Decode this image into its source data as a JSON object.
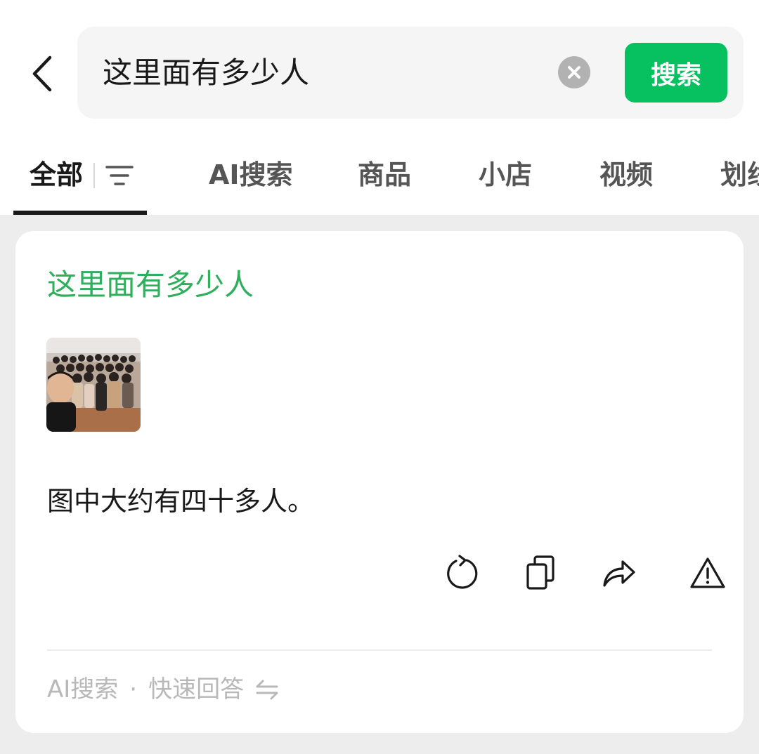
{
  "search": {
    "query": "这里面有多少人",
    "button_label": "搜索"
  },
  "tabs": [
    {
      "label": "全部",
      "active": true
    },
    {
      "label": "AI搜索"
    },
    {
      "label": "商品"
    },
    {
      "label": "小店"
    },
    {
      "label": "视频"
    },
    {
      "label": "划线"
    }
  ],
  "result": {
    "question": "这里面有多少人",
    "answer": "图中大约有四十多人。",
    "footer_source": "AI搜索",
    "footer_separator": "·",
    "footer_mode": "快速回答"
  },
  "icons": {
    "back": "chevron-left-icon",
    "clear": "clear-circle-icon",
    "filter": "filter-lines-icon",
    "regenerate": "refresh-icon",
    "copy": "copy-icon",
    "share": "share-arrow-icon",
    "report": "warning-triangle-icon",
    "switch": "switch-arrows-icon"
  },
  "colors": {
    "accent": "#07c160",
    "question_text": "#2fae5b",
    "background": "#ededed"
  }
}
